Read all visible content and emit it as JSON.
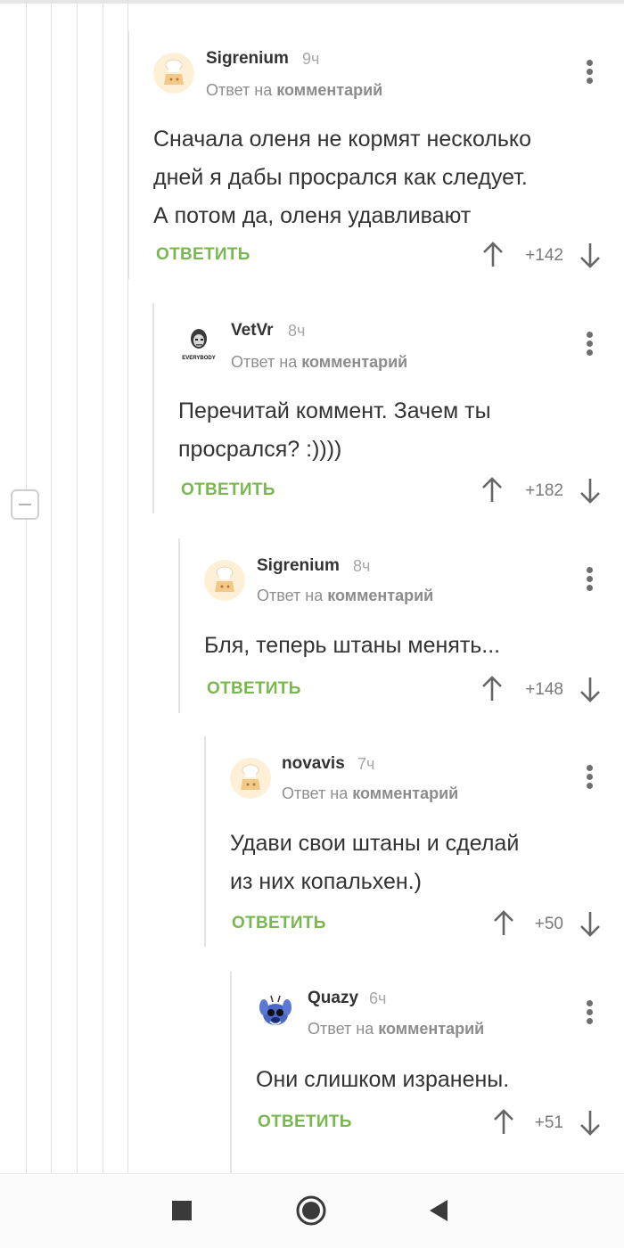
{
  "comments": [
    {
      "author": "Sigrenium",
      "time": "9ч",
      "reply_prefix": "Ответ на",
      "reply_target": "комментарий",
      "text_lines": [
        "Сначала оленя не кормят несколько",
        "дней я дабы просрался как следует.",
        "А потом да, оленя удавливают"
      ],
      "reply_label": "ОТВЕТИТЬ",
      "score": "+142",
      "avatar": "default-chef-avatar"
    },
    {
      "author": "VetVr",
      "time": "8ч",
      "reply_prefix": "Ответ на",
      "reply_target": "комментарий",
      "text_lines": [
        "Перечитай коммент. Зачем ты",
        "просрался? :))))"
      ],
      "reply_label": "ОТВЕТИТЬ",
      "score": "+182",
      "avatar": "portrait-avatar",
      "avatar_caption": "EVERYBODY"
    },
    {
      "author": "Sigrenium",
      "time": "8ч",
      "reply_prefix": "Ответ на",
      "reply_target": "комментарий",
      "text_lines": [
        "Бля, теперь штаны менять..."
      ],
      "reply_label": "ОТВЕТИТЬ",
      "score": "+148",
      "avatar": "default-chef-avatar"
    },
    {
      "author": "novavis",
      "time": "7ч",
      "reply_prefix": "Ответ на",
      "reply_target": "комментарий",
      "text_lines": [
        "Удави свои штаны и сделай",
        "из них копальхен.)"
      ],
      "reply_label": "ОТВЕТИТЬ",
      "score": "+50",
      "avatar": "default-chef-avatar"
    },
    {
      "author": "Quazy",
      "time": "6ч",
      "reply_prefix": "Ответ на",
      "reply_target": "комментарий",
      "text_lines": [
        "Они слишком изранены."
      ],
      "reply_label": "ОТВЕТИТЬ",
      "score": "+51",
      "avatar": "stitch-avatar"
    }
  ],
  "colors": {
    "accent": "#79b850",
    "text": "#333333",
    "muted": "#a7a7a7"
  },
  "icons": {
    "menu": "more-vert-icon",
    "up": "arrow-up-icon",
    "down": "arrow-down-icon",
    "nav": [
      "square-stop-icon",
      "home-circle-icon",
      "back-triangle-icon"
    ]
  }
}
